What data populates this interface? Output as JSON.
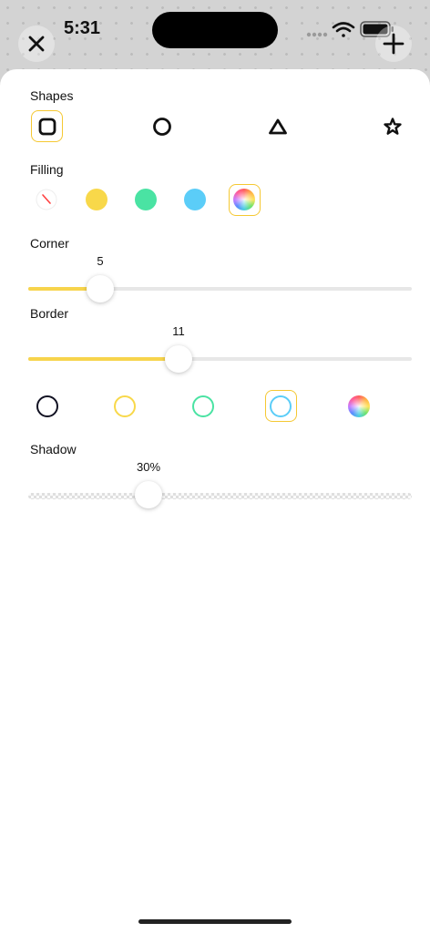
{
  "status": {
    "time": "5:31"
  },
  "sections": {
    "shapes": "Shapes",
    "filling": "Filling",
    "corner": "Corner",
    "border": "Border",
    "shadow": "Shadow"
  },
  "shapes": [
    {
      "name": "rounded-square",
      "selected": true
    },
    {
      "name": "circle",
      "selected": false
    },
    {
      "name": "triangle",
      "selected": false
    },
    {
      "name": "star",
      "selected": false
    }
  ],
  "filling": [
    {
      "name": "none",
      "color": "#ffffff",
      "selected": false
    },
    {
      "name": "yellow",
      "color": "#f8d84a",
      "selected": false
    },
    {
      "name": "green",
      "color": "#4ae3a3",
      "selected": false
    },
    {
      "name": "blue",
      "color": "#5bcdf8",
      "selected": false
    },
    {
      "name": "rainbow",
      "color": "rainbow",
      "selected": true
    }
  ],
  "corner": {
    "value": 5,
    "label": "5",
    "fraction": 0.187
  },
  "border": {
    "value": 11,
    "label": "11",
    "fraction": 0.39
  },
  "border_colors": [
    {
      "name": "black",
      "color": "#111122",
      "selected": false
    },
    {
      "name": "yellow",
      "color": "#f8d84a",
      "selected": false
    },
    {
      "name": "green",
      "color": "#4ae3a3",
      "selected": false
    },
    {
      "name": "blue",
      "color": "#5bcdf8",
      "selected": true
    },
    {
      "name": "rainbow",
      "color": "rainbow",
      "selected": false
    }
  ],
  "shadow": {
    "label": "30%",
    "fraction": 0.3
  },
  "colors": {
    "accent": "#f5c832",
    "track_fill": "#f7d44c",
    "track": "#e7e7e7"
  }
}
